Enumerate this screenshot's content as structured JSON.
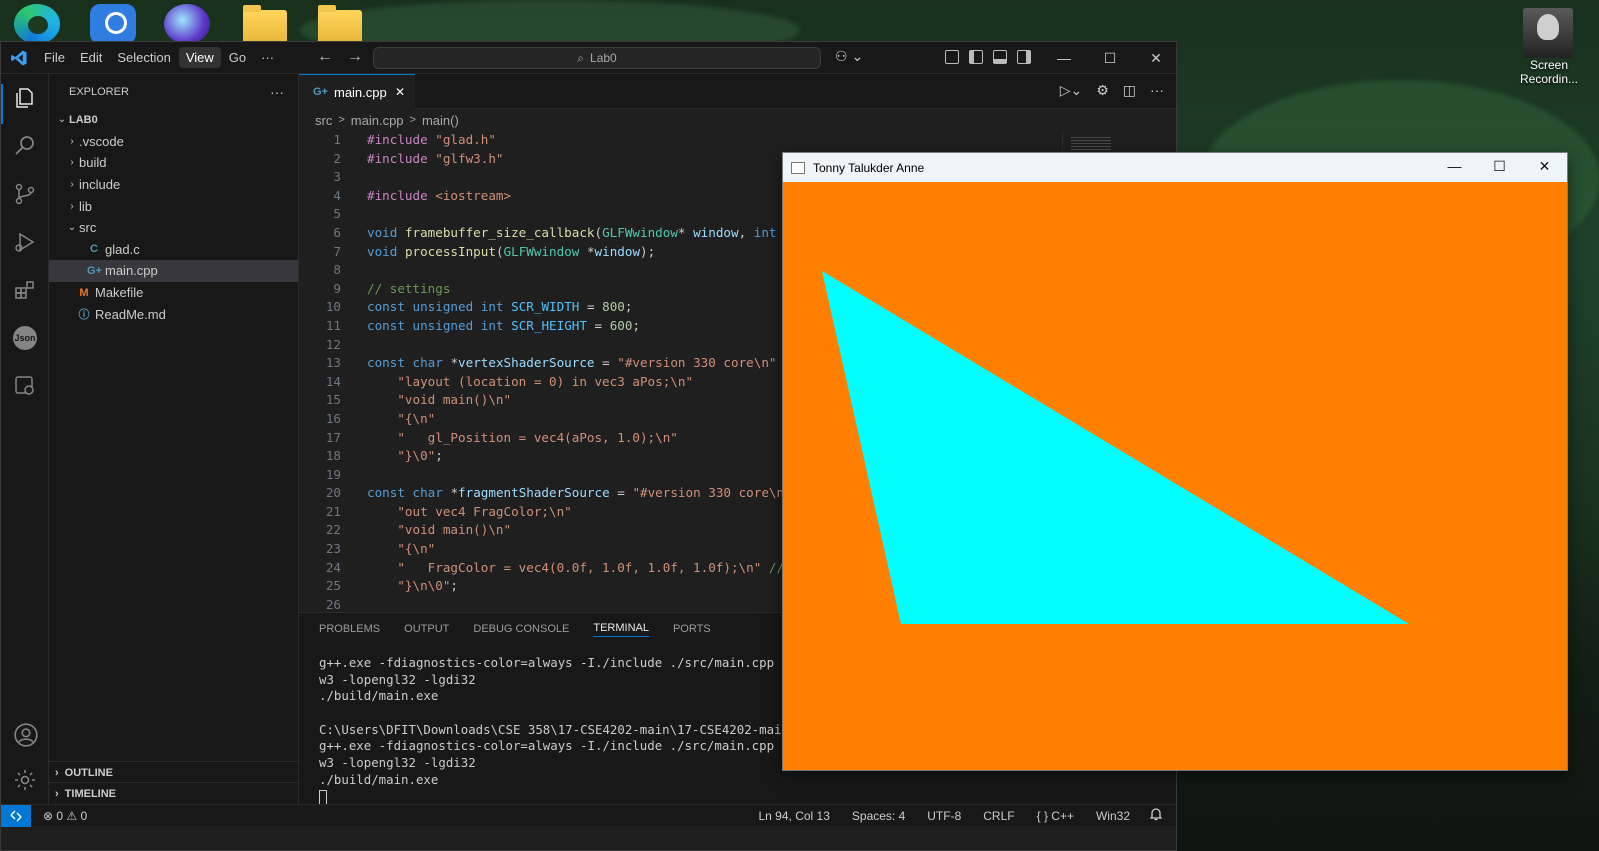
{
  "desktop": {
    "screen_recording_label": "Screen Recordin..."
  },
  "vscode": {
    "menu": [
      "File",
      "Edit",
      "Selection",
      "View",
      "Go",
      "···"
    ],
    "active_menu": "View",
    "search_label": "Lab0",
    "explorer_title": "EXPLORER",
    "explorer_more": "···",
    "tree": [
      {
        "label": "LAB0",
        "chev": "⌄",
        "icon": "",
        "indent": 6,
        "bold": true
      },
      {
        "label": ".vscode",
        "chev": "›",
        "icon": "",
        "indent": 16
      },
      {
        "label": "build",
        "chev": "›",
        "icon": "",
        "indent": 16
      },
      {
        "label": "include",
        "chev": "›",
        "icon": "",
        "indent": 16
      },
      {
        "label": "lib",
        "chev": "›",
        "icon": "",
        "indent": 16
      },
      {
        "label": "src",
        "chev": "⌄",
        "icon": "",
        "indent": 16
      },
      {
        "label": "glad.c",
        "chev": "",
        "icon": "C",
        "iconColor": "#519aba",
        "indent": 24
      },
      {
        "label": "main.cpp",
        "chev": "",
        "icon": "G+",
        "iconColor": "#519aba",
        "indent": 24,
        "selected": true
      },
      {
        "label": "Makefile",
        "chev": "",
        "icon": "M",
        "iconColor": "#e37933",
        "indent": 14
      },
      {
        "label": "ReadMe.md",
        "chev": "",
        "icon": "ⓘ",
        "iconColor": "#519aba",
        "indent": 14
      }
    ],
    "outline_label": "OUTLINE",
    "timeline_label": "TIMELINE",
    "tab_label": "main.cpp",
    "tab_close": "✕",
    "breadcrumb": [
      "src",
      ">",
      "main.cpp",
      ">",
      "main()"
    ],
    "code_lines": [
      {
        "n": "1",
        "t": "#include \"glad.h\""
      },
      {
        "n": "2",
        "t": "#include \"glfw3.h\""
      },
      {
        "n": "3",
        "t": ""
      },
      {
        "n": "4",
        "t": "#include <iostream>"
      },
      {
        "n": "5",
        "t": ""
      },
      {
        "n": "6",
        "t": "void framebuffer_size_callback(GLFWwindow* window, int w"
      },
      {
        "n": "7",
        "t": "void processInput(GLFWwindow *window);"
      },
      {
        "n": "8",
        "t": ""
      },
      {
        "n": "9",
        "t": "// settings"
      },
      {
        "n": "10",
        "t": "const unsigned int SCR_WIDTH = 800;"
      },
      {
        "n": "11",
        "t": "const unsigned int SCR_HEIGHT = 600;"
      },
      {
        "n": "12",
        "t": ""
      },
      {
        "n": "13",
        "t": "const char *vertexShaderSource = \"#version 330 core\\n\""
      },
      {
        "n": "14",
        "t": "    \"layout (location = 0) in vec3 aPos;\\n\""
      },
      {
        "n": "15",
        "t": "    \"void main()\\n\""
      },
      {
        "n": "16",
        "t": "    \"{\\n\""
      },
      {
        "n": "17",
        "t": "    \"   gl_Position = vec4(aPos, 1.0);\\n\""
      },
      {
        "n": "18",
        "t": "    \"}\\0\";"
      },
      {
        "n": "19",
        "t": ""
      },
      {
        "n": "20",
        "t": "const char *fragmentShaderSource = \"#version 330 core\\n"
      },
      {
        "n": "21",
        "t": "    \"out vec4 FragColor;\\n\""
      },
      {
        "n": "22",
        "t": "    \"void main()\\n\""
      },
      {
        "n": "23",
        "t": "    \"{\\n\""
      },
      {
        "n": "24",
        "t": "    \"   FragColor = vec4(0.0f, 1.0f, 1.0f, 1.0f);\\n\" //"
      },
      {
        "n": "25",
        "t": "    \"}\\n\\0\";"
      },
      {
        "n": "26",
        "t": ""
      }
    ],
    "panel_tabs": [
      "PROBLEMS",
      "OUTPUT",
      "DEBUG CONSOLE",
      "TERMINAL",
      "PORTS"
    ],
    "active_panel_tab": "TERMINAL",
    "terminal_lines": [
      "g++.exe -fdiagnostics-color=always -I./include ./src/main.cpp ./src/",
      "w3 -lopengl32 -lgdi32",
      "./build/main.exe",
      "",
      "C:\\Users\\DFIT\\Downloads\\CSE 358\\17-CSE4202-main\\17-CSE4202-main\\Lab0",
      "g++.exe -fdiagnostics-color=always -I./include ./src/main.cpp ./src/",
      "w3 -lopengl32 -lgdi32",
      "./build/main.exe"
    ],
    "status": {
      "remote": "⚡",
      "problems": "⊗ 0 ⚠ 0",
      "position": "Ln 94, Col 13",
      "spaces": "Spaces: 4",
      "encoding": "UTF-8",
      "eol": "CRLF",
      "language": "{ } C++",
      "platform": "Win32",
      "bell": "🔔"
    },
    "colors": {
      "accent": "#0078d4",
      "keyword": "#569cd6",
      "type": "#4ec9b0",
      "string": "#ce9178",
      "comment": "#6a9955",
      "preprocessor": "#c586c0",
      "number": "#b5cea8",
      "function": "#dcdcaa"
    }
  },
  "gl_window": {
    "title": "Tonny Talukder Anne",
    "minimize": "—",
    "maximize": "☐",
    "close": "✕",
    "background_color": "#ff8000",
    "triangle_color": "#00ffff"
  }
}
